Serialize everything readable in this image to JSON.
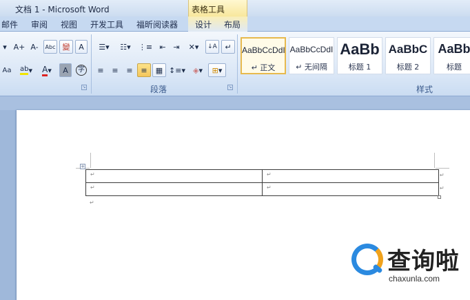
{
  "window": {
    "title": "文档 1 - Microsoft Word",
    "context_header": "表格工具"
  },
  "tabs": [
    "邮件",
    "审阅",
    "视图",
    "开发工具",
    "福昕阅读器"
  ],
  "context_tabs": [
    "设计",
    "布局"
  ],
  "ribbon": {
    "font_group": {
      "buttons": [
        "A+",
        "A-",
        "Abc",
        "變",
        "A",
        "Aa",
        "ab",
        "A",
        "A",
        "字"
      ]
    },
    "paragraph_group": {
      "label": "段落"
    },
    "styles_group": {
      "label": "样式",
      "styles": [
        {
          "sample": "AaBbCcDdI",
          "name": "↵ 正文",
          "selected": true
        },
        {
          "sample": "AaBbCcDdI",
          "name": "↵ 无间隔",
          "selected": false
        },
        {
          "sample": "AaBb",
          "name": "标题 1",
          "selected": false
        },
        {
          "sample": "AaBbC",
          "name": "标题 2",
          "selected": false
        },
        {
          "sample": "AaBb",
          "name": "标题",
          "selected": false
        }
      ]
    }
  },
  "document": {
    "table": {
      "rows": 2,
      "cols": 2,
      "cell_mark": "↵"
    },
    "paragraph_mark": "↵",
    "table_handle_icon": "move-handle-icon"
  },
  "watermark": {
    "text_cn": "查询啦",
    "url": "chaxunla.com"
  },
  "colors": {
    "accent_tab": "#f8e79c",
    "selected_style": "#e7b94d",
    "logo_blue": "#2b8ae0",
    "logo_orange": "#f0a21c"
  }
}
